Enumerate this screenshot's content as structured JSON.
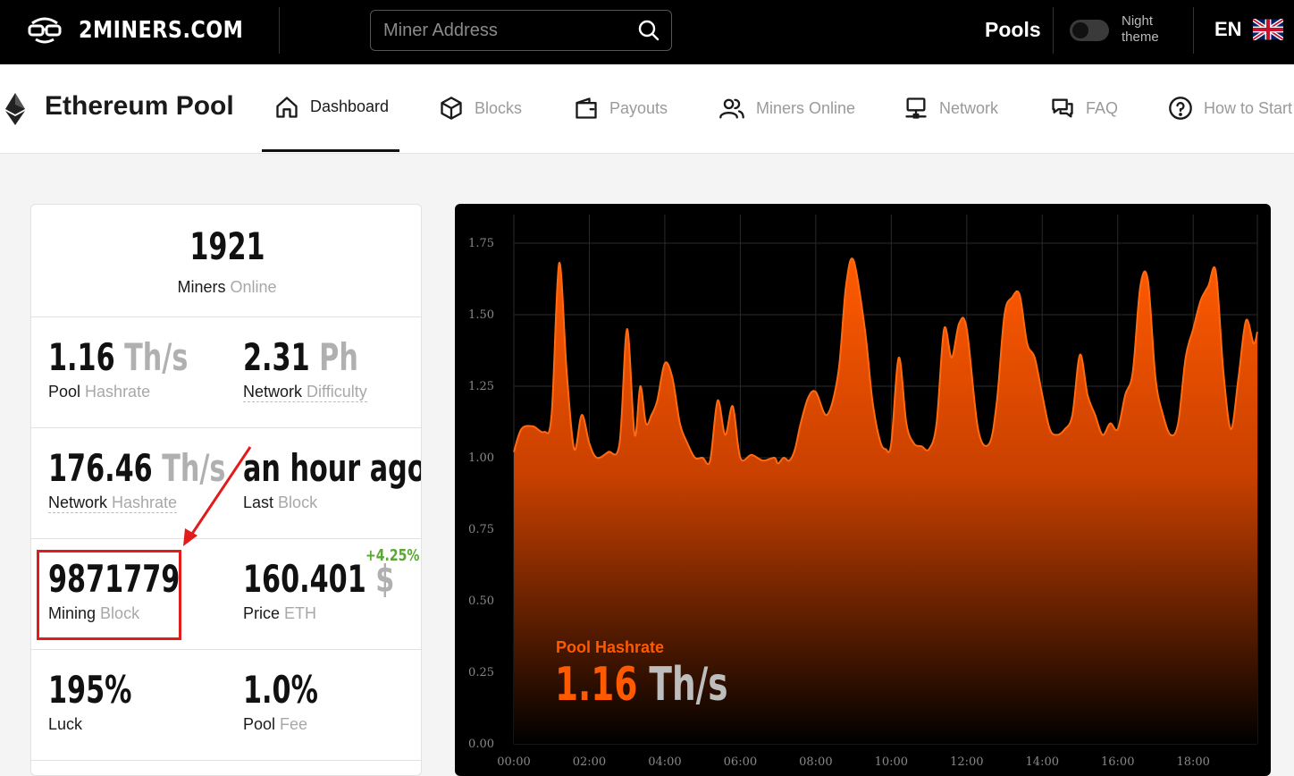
{
  "header": {
    "brand": "2MINERS.COM",
    "search_placeholder": "Miner Address",
    "pools_label": "Pools",
    "night_line1": "Night",
    "night_line2": "theme",
    "language": "EN",
    "night_theme_on": false,
    "icons": [
      "glasses-logo-icon",
      "search-icon",
      "uk-flag-icon"
    ]
  },
  "subnav": {
    "pool_title": "Ethereum Pool",
    "tabs": [
      {
        "label": "Dashboard",
        "icon": "home-icon",
        "active": true
      },
      {
        "label": "Blocks",
        "icon": "cube-icon",
        "active": false
      },
      {
        "label": "Payouts",
        "icon": "wallet-icon",
        "active": false
      },
      {
        "label": "Miners Online",
        "icon": "users-icon",
        "active": false
      },
      {
        "label": "Network",
        "icon": "network-icon",
        "active": false
      },
      {
        "label": "FAQ",
        "icon": "chat-icon",
        "active": false
      },
      {
        "label": "How to Start",
        "icon": "question-icon",
        "active": false
      }
    ]
  },
  "stats": {
    "miners_online": {
      "value": "1921",
      "label_main": "Miners",
      "label_muted": "Online"
    },
    "pool_hashrate": {
      "value": "1.16",
      "unit": "Th/s",
      "label_main": "Pool",
      "label_muted": "Hashrate"
    },
    "network_difficulty": {
      "value": "2.31",
      "unit": "Ph",
      "label_main": "Network",
      "label_muted": "Difficulty"
    },
    "network_hashrate": {
      "value": "176.46",
      "unit": "Th/s",
      "label_main": "Network",
      "label_muted": "Hashrate"
    },
    "last_block": {
      "value": "an hour ago",
      "label_main": "Last",
      "label_muted": "Block"
    },
    "mining_block": {
      "value": "9871779",
      "label_main": "Mining",
      "label_muted": "Block"
    },
    "price": {
      "value": "160.401",
      "unit": "$",
      "change": "+4.25%",
      "label_main": "Price",
      "label_muted": "ETH"
    },
    "luck": {
      "value": "195%",
      "label_main": "Luck"
    },
    "pool_fee": {
      "value": "1.0%",
      "label_main": "Pool",
      "label_muted": "Fee"
    }
  },
  "colors": {
    "accent": "#ff5a00",
    "highlight": "#e21b1b",
    "positive": "#5aa832"
  },
  "chart_data": {
    "type": "area",
    "legend_title": "Pool Hashrate",
    "legend_value": "1.16",
    "legend_unit": "Th/s",
    "xlim": [
      0,
      19.7
    ],
    "ylim": [
      0,
      1.85
    ],
    "x_ticks": [
      "00:00",
      "02:00",
      "04:00",
      "06:00",
      "08:00",
      "10:00",
      "12:00",
      "14:00",
      "16:00",
      "18:00"
    ],
    "y_ticks": [
      "0.00",
      "0.25",
      "0.50",
      "0.75",
      "1.00",
      "1.25",
      "1.50",
      "1.75"
    ],
    "grid": true,
    "series": [
      {
        "name": "Pool Hashrate",
        "x": [
          0,
          0.2,
          0.5,
          0.8,
          1.0,
          1.2,
          1.4,
          1.6,
          1.8,
          2.0,
          2.2,
          2.5,
          2.8,
          3.0,
          3.2,
          3.35,
          3.5,
          3.65,
          3.8,
          4.0,
          4.2,
          4.4,
          4.6,
          4.8,
          5.0,
          5.2,
          5.4,
          5.6,
          5.8,
          6.0,
          6.3,
          6.6,
          6.9,
          7.0,
          7.15,
          7.3,
          7.45,
          7.6,
          7.8,
          8.0,
          8.3,
          8.6,
          8.8,
          9.0,
          9.3,
          9.5,
          9.7,
          9.85,
          10.0,
          10.2,
          10.4,
          10.6,
          10.8,
          11.0,
          11.2,
          11.4,
          11.6,
          11.8,
          12.0,
          12.3,
          12.6,
          12.8,
          13.0,
          13.2,
          13.4,
          13.6,
          13.8,
          14.0,
          14.2,
          14.4,
          14.6,
          14.8,
          15.0,
          15.2,
          15.4,
          15.6,
          15.8,
          16.0,
          16.2,
          16.4,
          16.6,
          16.8,
          17.0,
          17.2,
          17.4,
          17.6,
          17.8,
          18.0,
          18.2,
          18.4,
          18.6,
          18.8,
          19.0,
          19.2,
          19.4,
          19.6,
          19.7
        ],
        "values": [
          1.02,
          1.1,
          1.11,
          1.09,
          1.15,
          1.68,
          1.3,
          1.03,
          1.15,
          1.05,
          1.0,
          1.02,
          1.05,
          1.45,
          1.08,
          1.25,
          1.12,
          1.15,
          1.2,
          1.33,
          1.28,
          1.12,
          1.05,
          1.0,
          1.0,
          0.99,
          1.2,
          1.08,
          1.18,
          1.0,
          1.01,
          0.99,
          1.0,
          0.98,
          1.0,
          0.99,
          1.03,
          1.12,
          1.21,
          1.23,
          1.15,
          1.3,
          1.6,
          1.69,
          1.45,
          1.2,
          1.06,
          1.03,
          1.05,
          1.35,
          1.12,
          1.05,
          1.04,
          1.03,
          1.12,
          1.45,
          1.35,
          1.47,
          1.45,
          1.1,
          1.05,
          1.2,
          1.5,
          1.56,
          1.57,
          1.4,
          1.35,
          1.22,
          1.1,
          1.08,
          1.1,
          1.15,
          1.36,
          1.22,
          1.15,
          1.08,
          1.12,
          1.1,
          1.22,
          1.3,
          1.6,
          1.62,
          1.28,
          1.15,
          1.08,
          1.12,
          1.35,
          1.45,
          1.55,
          1.6,
          1.65,
          1.3,
          1.1,
          1.28,
          1.48,
          1.4,
          1.44
        ]
      }
    ]
  }
}
